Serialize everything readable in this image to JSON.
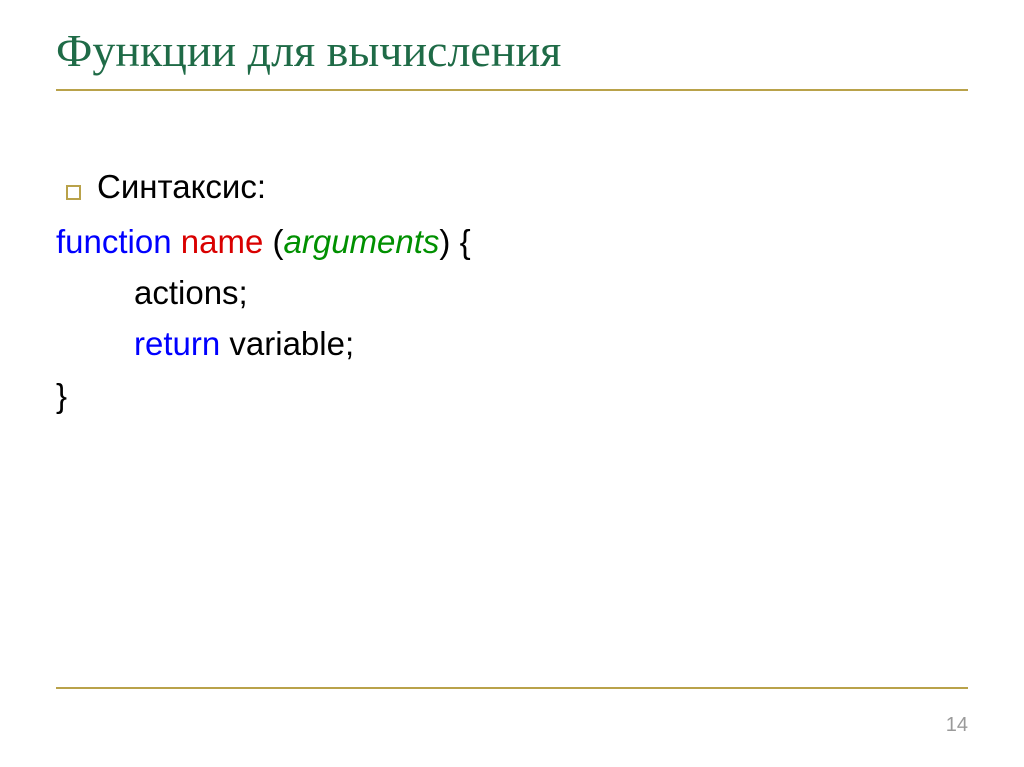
{
  "title": "Функции для вычисления",
  "bullet_label": "Синтаксис:",
  "code": {
    "kw_function": "function",
    "name": "name",
    "paren_open": "(",
    "arguments": "arguments",
    "paren_close_brace": ") {",
    "actions": "actions;",
    "kw_return": "return",
    "variable": "variable;",
    "brace_close": "}"
  },
  "page_number": "14"
}
